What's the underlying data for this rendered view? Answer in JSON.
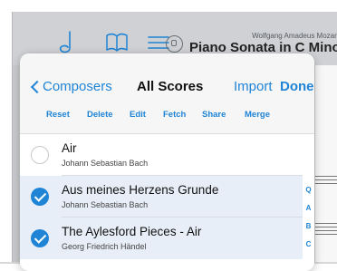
{
  "toolbar": {
    "icons": [
      "pencil-icon",
      "book-icon",
      "list-icon",
      "search-icon"
    ],
    "composer": "Wolfgang Amadeus Mozart",
    "score_title": "Piano Sonata in C Minor,"
  },
  "popover": {
    "nav": {
      "back_label": "Composers",
      "title": "All Scores",
      "import_label": "Import",
      "done_label": "Done"
    },
    "actions": [
      "Reset",
      "Delete",
      "Edit",
      "Fetch",
      "Share",
      "Merge"
    ],
    "rows": [
      {
        "title": "Air",
        "subtitle": "Johann Sebastian Bach",
        "selected": false
      },
      {
        "title": "Aus meines Herzens Grunde",
        "subtitle": "Johann Sebastian Bach",
        "selected": true
      },
      {
        "title": "The Aylesford Pieces - Air",
        "subtitle": "Georg Friedrich Händel",
        "selected": true
      }
    ],
    "index": [
      "Q",
      "A",
      "B",
      "C"
    ]
  },
  "colors": {
    "accent": "#1f84d6",
    "selected_row": "#e7eef8",
    "toolbar": "#cfd1d4"
  }
}
